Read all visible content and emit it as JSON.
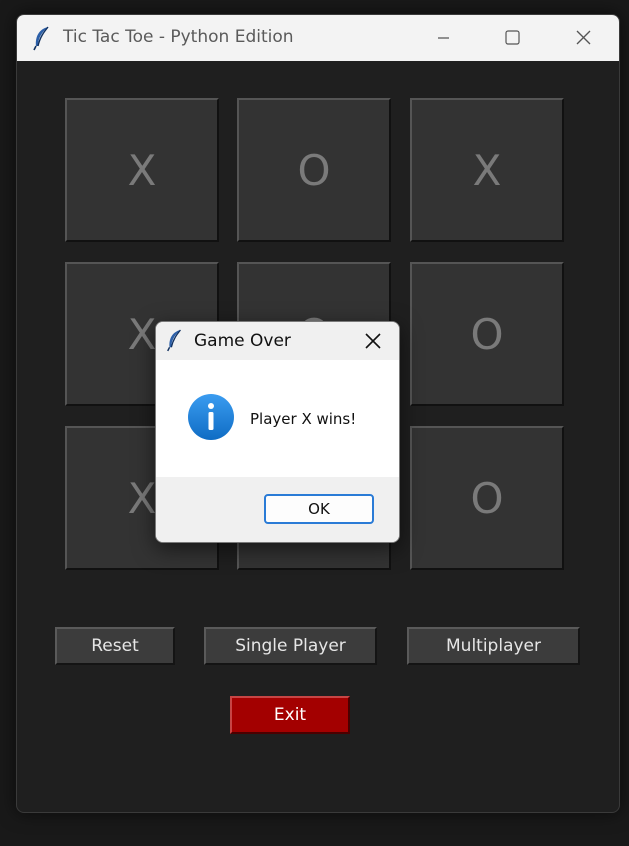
{
  "window": {
    "title": "Tic Tac Toe - Python Edition",
    "icons": {
      "app": "feather-icon",
      "minimize": "minimize-icon",
      "maximize": "maximize-icon",
      "close": "close-icon"
    }
  },
  "board": {
    "cells": [
      {
        "row": 0,
        "col": 0,
        "mark": "X"
      },
      {
        "row": 0,
        "col": 1,
        "mark": "O"
      },
      {
        "row": 0,
        "col": 2,
        "mark": "X"
      },
      {
        "row": 1,
        "col": 0,
        "mark": "X"
      },
      {
        "row": 1,
        "col": 1,
        "mark": "O"
      },
      {
        "row": 1,
        "col": 2,
        "mark": "O"
      },
      {
        "row": 2,
        "col": 0,
        "mark": "X"
      },
      {
        "row": 2,
        "col": 1,
        "mark": ""
      },
      {
        "row": 2,
        "col": 2,
        "mark": "O"
      }
    ]
  },
  "controls": {
    "reset_label": "Reset",
    "single_label": "Single Player",
    "multi_label": "Multiplayer",
    "exit_label": "Exit"
  },
  "dialog": {
    "title": "Game Over",
    "message": "Player X wins!",
    "ok_label": "OK",
    "icons": {
      "app": "feather-icon",
      "close": "close-icon",
      "info": "info-icon"
    }
  },
  "colors": {
    "exit_button": "#a30000",
    "info_icon": "#1a7fd8",
    "ok_border": "#2a7bd6"
  }
}
